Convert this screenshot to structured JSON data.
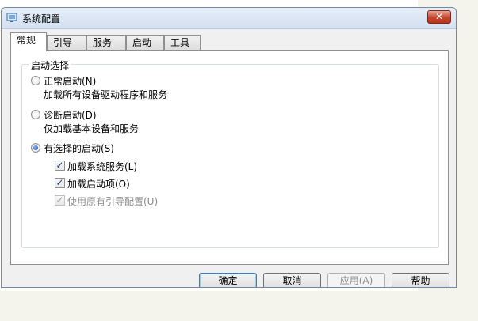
{
  "window": {
    "title": "系统配置",
    "close_glyph": "✕"
  },
  "tabs": [
    {
      "label": "常规",
      "active": true
    },
    {
      "label": "引导",
      "active": false
    },
    {
      "label": "服务",
      "active": false
    },
    {
      "label": "启动",
      "active": false
    },
    {
      "label": "工具",
      "active": false
    }
  ],
  "startup_group": {
    "title": "启动选择",
    "normal": {
      "label": "正常启动(N)",
      "desc": "加载所有设备驱动程序和服务",
      "selected": false
    },
    "diagnostic": {
      "label": "诊断启动(D)",
      "desc": "仅加载基本设备和服务",
      "selected": false
    },
    "selective": {
      "label": "有选择的启动(S)",
      "selected": true,
      "options": [
        {
          "label": "加载系统服务(L)",
          "checked": true,
          "enabled": true
        },
        {
          "label": "加载启动项(O)",
          "checked": true,
          "enabled": true
        },
        {
          "label": "使用原有引导配置(U)",
          "checked": true,
          "enabled": false
        }
      ]
    }
  },
  "buttons": {
    "ok": "确定",
    "cancel": "取消",
    "apply": "应用(A)",
    "help": "帮助"
  }
}
